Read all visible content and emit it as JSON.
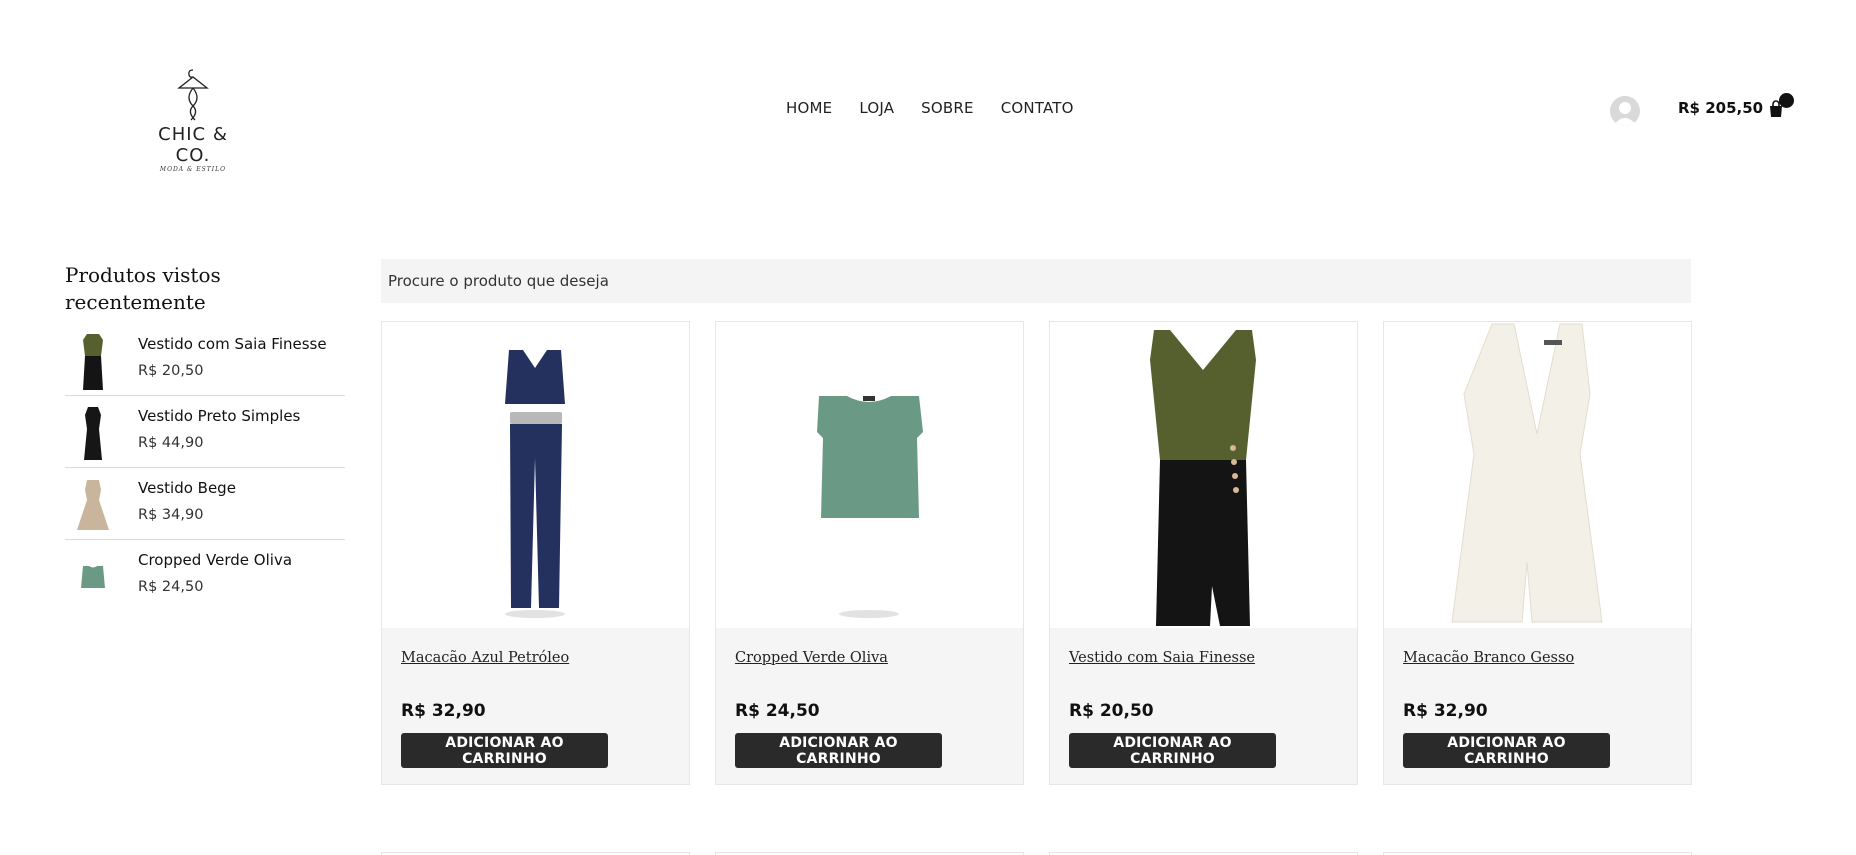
{
  "header": {
    "logo": {
      "brand": "CHIC & CO.",
      "tagline": "MODA & ESTILO",
      "icon": "hanger-figure-icon"
    },
    "nav": [
      "HOME",
      "LOJA",
      "SOBRE",
      "CONTATO"
    ],
    "cart_total": "R$ 205,50",
    "cart_icon": "shopping-bag-icon",
    "user_icon": "avatar-icon"
  },
  "sidebar": {
    "title": "Produtos vistos recentemente",
    "items": [
      {
        "name": "Vestido com Saia Finesse",
        "price": "R$ 20,50"
      },
      {
        "name": "Vestido Preto Simples",
        "price": "R$ 44,90"
      },
      {
        "name": "Vestido Bege",
        "price": "R$ 34,90"
      },
      {
        "name": "Cropped Verde Oliva",
        "price": "R$ 24,50"
      }
    ]
  },
  "search": {
    "placeholder": "Procure o produto que deseja"
  },
  "products": [
    {
      "name": "Macacão Azul Petróleo",
      "price": "R$ 32,90",
      "button": "ADICIONAR AO CARRINHO"
    },
    {
      "name": "Cropped Verde Oliva",
      "price": "R$ 24,50",
      "button": "ADICIONAR AO CARRINHO"
    },
    {
      "name": "Vestido com Saia Finesse",
      "price": "R$ 20,50",
      "button": "ADICIONAR AO CARRINHO"
    },
    {
      "name": "Macacão Branco Gesso",
      "price": "R$ 32,90",
      "button": "ADICIONAR AO CARRINHO"
    }
  ],
  "colors": {
    "button_bg": "#2a2a2a",
    "card_bg": "#f5f5f5",
    "search_bg": "#f4f4f4",
    "navy": "#24315e",
    "sage": "#6a9a86",
    "olive": "#56602f",
    "ivory": "#f3f0e8",
    "beige": "#c9b59c"
  }
}
